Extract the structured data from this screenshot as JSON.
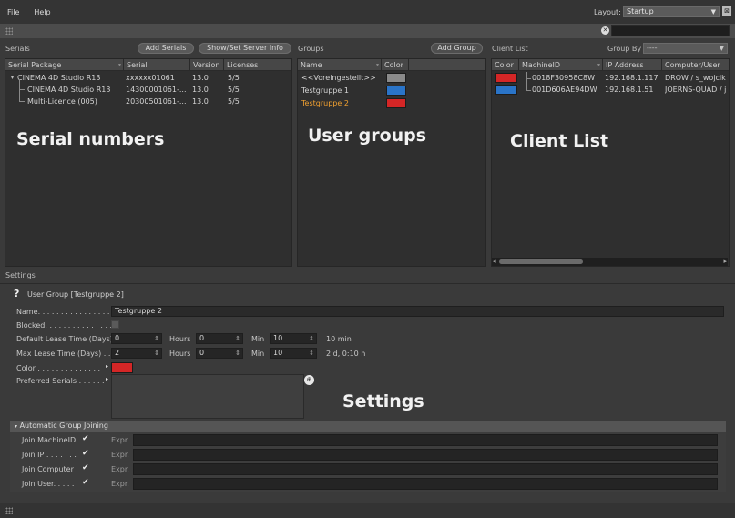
{
  "menu": {
    "file": "File",
    "help": "Help"
  },
  "layout": {
    "label": "Layout:",
    "value": "Startup"
  },
  "serials": {
    "title": "Serials",
    "add_button": "Add Serials",
    "server_button": "Show/Set Server Info",
    "columns": [
      "Serial Package",
      "Serial",
      "Version",
      "Licenses"
    ],
    "rows": [
      {
        "package": "CINEMA 4D Studio R13",
        "serial": "xxxxxx01061",
        "version": "13.0",
        "licenses": "5/5"
      },
      {
        "package": "CINEMA 4D Studio R13",
        "serial": "14300001061-...",
        "version": "13.0",
        "licenses": "5/5"
      },
      {
        "package": "Multi-Licence (005)",
        "serial": "20300501061-...",
        "version": "13.0",
        "licenses": "5/5"
      }
    ],
    "overlay": "Serial numbers"
  },
  "groups": {
    "title": "Groups",
    "add_button": "Add Group",
    "columns": [
      "Name",
      "Color"
    ],
    "rows": [
      {
        "name": "<<Voreingestellt>>",
        "color": "#8a8a8a"
      },
      {
        "name": "Testgruppe 1",
        "color": "#2a74c8"
      },
      {
        "name": "Testgruppe 2",
        "color": "#d42626"
      }
    ],
    "overlay": "User groups"
  },
  "clients": {
    "title": "Client List",
    "group_by_label": "Group By",
    "group_by_value": "----",
    "columns": [
      "Color",
      "MachineID",
      "IP Address",
      "Computer/User"
    ],
    "rows": [
      {
        "color": "#d42626",
        "machine": "0018F30958C8W",
        "ip": "192.168.1.117",
        "user": "DROW / s_wojcik"
      },
      {
        "color": "#2a74c8",
        "machine": "001D606AE94DW",
        "ip": "192.168.1.51",
        "user": "JOERNS-QUAD / j"
      }
    ],
    "overlay": "Client List"
  },
  "settings": {
    "title": "Settings",
    "header": "User Group [Testgruppe 2]",
    "overlay": "Settings",
    "name_label": "Name. . . . . . . . . . . . . . . .",
    "name_value": "Testgruppe 2",
    "blocked_label": "Blocked. . . . . . . . . . . . . . .",
    "default_lease_label": "Default Lease Time (Days)",
    "default_days": "0",
    "hours_label": "Hours",
    "default_hours": "0",
    "min_label": "Min",
    "default_min": "10",
    "default_summary": "10 min",
    "max_lease_label": "Max Lease Time (Days) . .",
    "max_days": "2",
    "max_hours": "0",
    "max_min": "10",
    "max_summary": "2 d, 0:10 h",
    "color_label": "Color . . . . . . . . . . . . . .",
    "color_value": "#d42626",
    "pref_label": "Preferred Serials . . . . . .",
    "agj_title": "Automatic Group Joining",
    "join_rows": [
      {
        "label": "Join MachineID",
        "expr": "Expr."
      },
      {
        "label": "Join IP . . . . . . .",
        "expr": "Expr."
      },
      {
        "label": "Join Computer",
        "expr": "Expr."
      },
      {
        "label": "Join User. . . . .",
        "expr": "Expr."
      }
    ]
  },
  "icons": {
    "search_clear": "close-circle-icon",
    "help": "question-icon",
    "target": "target-icon"
  }
}
